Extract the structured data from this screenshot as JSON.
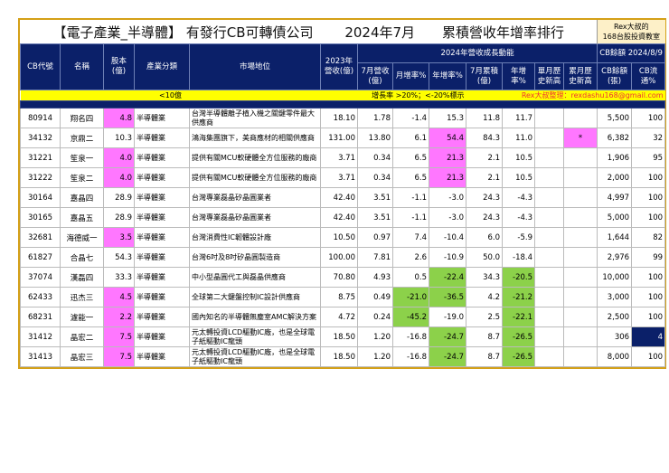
{
  "title": {
    "main": "【電子產業_半導體】 有發行CB可轉債公司　　 2024年7月　　累積營收年增率排行",
    "side1": "Rex大叔的",
    "side2": "168台股投資教室"
  },
  "headers": {
    "code": "CB代號",
    "name": "名稱",
    "capital": "股本(億)",
    "industry": "產業分類",
    "market": "市場地位",
    "rev2023": "2023年營收(億)",
    "group2024": "2024年營收成長動能",
    "cb_group": "CB餘額 2024/8/9",
    "jul_rev": "7月營收(億)",
    "mom": "月增率%",
    "yoy": "年增率%",
    "cum": "7月累積(億)",
    "cum_yoy": "年增率%",
    "single_high": "單月歷史新高",
    "cum_high": "累月歷史新高",
    "cb_bal": "CB餘額(張)",
    "cb_float": "CB流通%"
  },
  "legend": {
    "small": "<10億",
    "rate": "增長率 >20%；<-20%標示",
    "author": "Rex大叔整理：rexdashu168@gmail.com"
  },
  "colors": {
    "pink": "#ff77ff",
    "green": "#8cd14a",
    "navy": "#0b2069"
  },
  "rows": [
    {
      "code": "80914",
      "name": "翔名四",
      "capital": "4.8",
      "industry": "半導體業",
      "market": "台灣半導體離子植入機之關鍵零件最大供應商",
      "rev2023": "18.10",
      "jul": "1.78",
      "mom": "-1.4",
      "yoy": "15.3",
      "cum": "11.8",
      "cyoy": "11.7",
      "sh": "",
      "ch": "",
      "bal": "5,500",
      "fl": "100",
      "hl": [
        "capital"
      ]
    },
    {
      "code": "34132",
      "name": "京鼎二",
      "capital": "10.3",
      "industry": "半導體業",
      "market": "鴻海集團旗下，美商應材的相關供應商",
      "rev2023": "131.00",
      "jul": "13.80",
      "mom": "6.1",
      "yoy": "54.4",
      "cum": "84.3",
      "cyoy": "11.0",
      "sh": "",
      "ch": "*",
      "bal": "6,382",
      "fl": "32",
      "hl": [
        "yoy",
        "ch"
      ]
    },
    {
      "code": "31221",
      "name": "笙泉一",
      "capital": "4.0",
      "industry": "半導體業",
      "market": "提供有關MCU軟硬體全方位服務的廠商",
      "rev2023": "3.71",
      "jul": "0.34",
      "mom": "6.5",
      "yoy": "21.3",
      "cum": "2.1",
      "cyoy": "10.5",
      "sh": "",
      "ch": "",
      "bal": "1,906",
      "fl": "95",
      "hl": [
        "capital",
        "yoy"
      ]
    },
    {
      "code": "31222",
      "name": "笙泉二",
      "capital": "4.0",
      "industry": "半導體業",
      "market": "提供有關MCU軟硬體全方位服務的廠商",
      "rev2023": "3.71",
      "jul": "0.34",
      "mom": "6.5",
      "yoy": "21.3",
      "cum": "2.1",
      "cyoy": "10.5",
      "sh": "",
      "ch": "",
      "bal": "2,000",
      "fl": "100",
      "hl": [
        "capital",
        "yoy"
      ]
    },
    {
      "code": "30164",
      "name": "嘉晶四",
      "capital": "28.9",
      "industry": "半導體業",
      "market": "台灣專業磊晶矽晶圓業者",
      "rev2023": "42.40",
      "jul": "3.51",
      "mom": "-1.1",
      "yoy": "-3.0",
      "cum": "24.3",
      "cyoy": "-4.3",
      "sh": "",
      "ch": "",
      "bal": "4,997",
      "fl": "100",
      "hl": []
    },
    {
      "code": "30165",
      "name": "嘉晶五",
      "capital": "28.9",
      "industry": "半導體業",
      "market": "台灣專業磊晶矽晶圓業者",
      "rev2023": "42.40",
      "jul": "3.51",
      "mom": "-1.1",
      "yoy": "-3.0",
      "cum": "24.3",
      "cyoy": "-4.3",
      "sh": "",
      "ch": "",
      "bal": "5,000",
      "fl": "100",
      "hl": []
    },
    {
      "code": "32681",
      "name": "海德威一",
      "capital": "3.5",
      "industry": "半導體業",
      "market": "台灣消費性IC韌體設計廠",
      "rev2023": "10.50",
      "jul": "0.97",
      "mom": "7.4",
      "yoy": "-10.4",
      "cum": "6.0",
      "cyoy": "-5.9",
      "sh": "",
      "ch": "",
      "bal": "1,644",
      "fl": "82",
      "hl": [
        "capital"
      ]
    },
    {
      "code": "61827",
      "name": "合晶七",
      "capital": "54.3",
      "industry": "半導體業",
      "market": "台灣6吋及8吋矽晶圓製造商",
      "rev2023": "100.00",
      "jul": "7.81",
      "mom": "2.6",
      "yoy": "-10.9",
      "cum": "50.0",
      "cyoy": "-18.4",
      "sh": "",
      "ch": "",
      "bal": "2,976",
      "fl": "99",
      "hl": []
    },
    {
      "code": "37074",
      "name": "漢磊四",
      "capital": "33.3",
      "industry": "半導體業",
      "market": "中小型晶圓代工與磊晶供應商",
      "rev2023": "70.80",
      "jul": "4.93",
      "mom": "0.5",
      "yoy": "-22.4",
      "cum": "34.3",
      "cyoy": "-20.5",
      "sh": "",
      "ch": "",
      "bal": "10,000",
      "fl": "100",
      "hl": [
        "yoy",
        "cyoy"
      ]
    },
    {
      "code": "62433",
      "name": "迅杰三",
      "capital": "4.5",
      "industry": "半導體業",
      "market": "全球第二大鍵盤控制IC設計供應商",
      "rev2023": "8.75",
      "jul": "0.49",
      "mom": "-21.0",
      "yoy": "-36.5",
      "cum": "4.2",
      "cyoy": "-21.2",
      "sh": "",
      "ch": "",
      "bal": "3,000",
      "fl": "100",
      "hl": [
        "capital",
        "mom",
        "yoy",
        "cyoy"
      ]
    },
    {
      "code": "68231",
      "name": "濾能一",
      "capital": "2.2",
      "industry": "半導體業",
      "market": "國內知名的半導體無塵室AMC解決方案",
      "rev2023": "4.72",
      "jul": "0.24",
      "mom": "-45.2",
      "yoy": "-19.0",
      "cum": "2.5",
      "cyoy": "-22.1",
      "sh": "",
      "ch": "",
      "bal": "2,500",
      "fl": "100",
      "hl": [
        "capital",
        "mom",
        "cyoy"
      ]
    },
    {
      "code": "31412",
      "name": "晶宏二",
      "capital": "7.5",
      "industry": "半導體業",
      "market": "元太轉投資LCD驅動IC廠，也是全球電子紙驅動IC龍頭",
      "rev2023": "18.50",
      "jul": "1.20",
      "mom": "-16.8",
      "yoy": "-24.7",
      "cum": "8.7",
      "cyoy": "-26.5",
      "sh": "",
      "ch": "",
      "bal": "306",
      "fl": "4",
      "hl": [
        "capital",
        "yoy",
        "cyoy",
        "fl"
      ]
    },
    {
      "code": "31413",
      "name": "晶宏三",
      "capital": "7.5",
      "industry": "半導體業",
      "market": "元太轉投資LCD驅動IC廠，也是全球電子紙驅動IC龍頭",
      "rev2023": "18.50",
      "jul": "1.20",
      "mom": "-16.8",
      "yoy": "-24.7",
      "cum": "8.7",
      "cyoy": "-26.5",
      "sh": "",
      "ch": "",
      "bal": "8,000",
      "fl": "100",
      "hl": [
        "capital",
        "yoy",
        "cyoy"
      ]
    }
  ]
}
